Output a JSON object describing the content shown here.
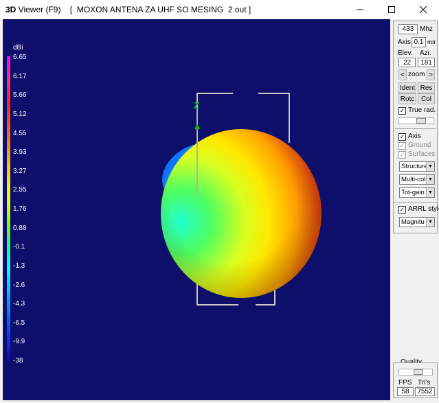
{
  "window": {
    "app_name_bold": "3D",
    "app_name_rest": " Viewer (F9)",
    "document": "[  MOXON ANTENA ZA UHF SO MESING  2.out ]",
    "minimize_icon": "minimize-icon",
    "maximize_icon": "maximize-icon",
    "close_icon": "close-icon"
  },
  "legend": {
    "unit": "dBi",
    "labels": [
      "6.65",
      "6.17",
      "5.66",
      "5.12",
      "4.55",
      "3.93",
      "3.27",
      "2.55",
      "1.76",
      "0.88",
      "-0.1",
      "-1.3",
      "-2.6",
      "-4.3",
      "-6.5",
      "-9.9",
      "-38"
    ]
  },
  "axis_label": "Z",
  "controls": {
    "frequency": "433",
    "frequency_unit": "Mhz",
    "axis_label": "Axis",
    "axis_value": "0.1",
    "axis_unit": "mtr",
    "elev_label": "Elev.",
    "azi_label": "Azi.",
    "elev_value": "22",
    "azi_value": "181",
    "zoom_left": "<",
    "zoom_label": "zoom",
    "zoom_right": ">",
    "ident_button": "Ident",
    "res_button": "Res",
    "rotc_button": "Rotc",
    "col_button": "Col",
    "true_rad_label": "True rad.",
    "true_rad_checked": true,
    "axis_check_label": "Axis",
    "ground_label": "Ground",
    "surfaces_label": "Surfaces",
    "structure_select": "Structure",
    "color_select": "Multi-colo",
    "gain_select": "Tot-gain",
    "arrl_label": "ARRL style",
    "magnitude_select": "Magnitu",
    "quality_label": "Quality",
    "fps_label": "FPS",
    "tris_label": "Tri's",
    "fps_value": "58",
    "tris_value": "7552"
  }
}
